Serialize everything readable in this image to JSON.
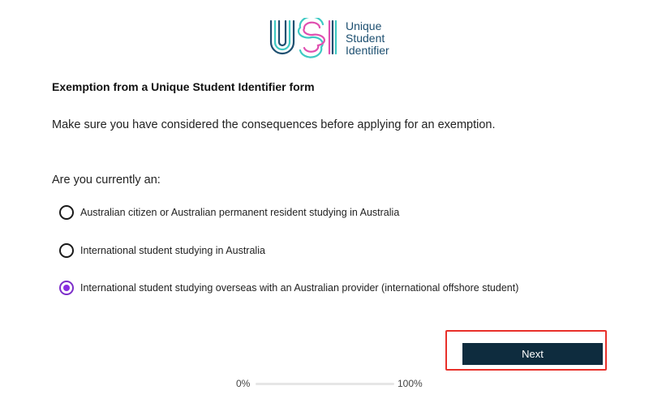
{
  "logo": {
    "mark": "USI",
    "line1": "Unique",
    "line2": "Student",
    "line3": "Identifier"
  },
  "form": {
    "title": "Exemption from a Unique Student Identifier form",
    "intro": "Make sure you have considered the consequences before applying for an exemption.",
    "question": "Are you currently an:",
    "options": [
      {
        "label": "Australian citizen or Australian permanent resident studying in Australia",
        "selected": false
      },
      {
        "label": "International student studying in Australia",
        "selected": false
      },
      {
        "label": "International student studying overseas with an Australian provider (international offshore student)",
        "selected": true
      }
    ],
    "next_label": "Next"
  },
  "progress": {
    "start_label": "0%",
    "end_label": "100%",
    "value": 0
  },
  "colors": {
    "brand_navy": "#1d4f70",
    "brand_teal": "#3ec9c3",
    "brand_pink": "#e04fb0",
    "accent_purple": "#8a2be2",
    "button_bg": "#0e2c3e",
    "highlight_red": "#e8302a"
  }
}
